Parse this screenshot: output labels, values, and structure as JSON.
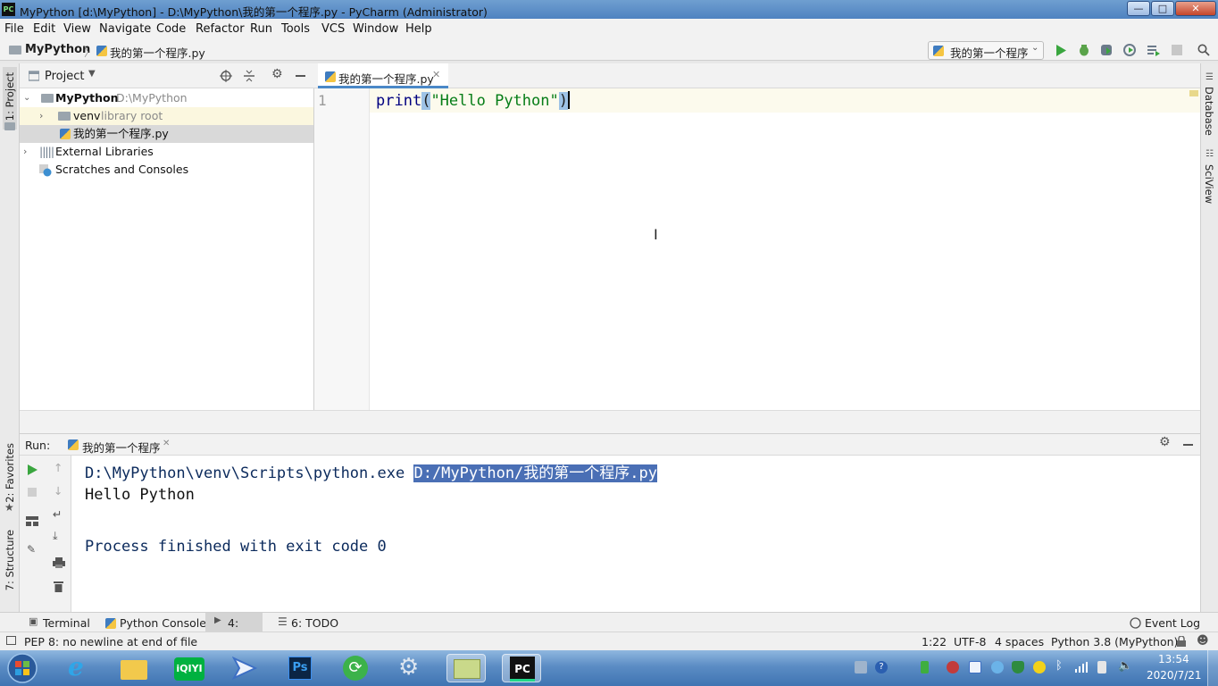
{
  "window": {
    "title": "MyPython [d:\\MyPython] - D:\\MyPython\\我的第一个程序.py - PyCharm (Administrator)",
    "app_icon_text": "PC",
    "minimize": "—",
    "maximize": "□",
    "close": "✕"
  },
  "menu": [
    "File",
    "Edit",
    "View",
    "Navigate",
    "Code",
    "Refactor",
    "Run",
    "Tools",
    "VCS",
    "Window",
    "Help"
  ],
  "breadcrumb": {
    "project": "MyPython",
    "file": "我的第一个程序.py"
  },
  "run_config": {
    "selected": "我的第一个程序"
  },
  "left_strip": {
    "project": "1: Project",
    "favorites": "2: Favorites",
    "structure": "7: Structure"
  },
  "right_strip": {
    "database": "Database",
    "sciview": "SciView"
  },
  "project_panel": {
    "title": "Project",
    "tree": {
      "root": {
        "name": "MyPython",
        "path": "D:\\MyPython"
      },
      "venv": {
        "name": "venv",
        "note": "library root"
      },
      "file": "我的第一个程序.py",
      "external": "External Libraries",
      "scratches": "Scratches and Consoles"
    }
  },
  "editor": {
    "tab": "我的第一个程序.py",
    "line_number": "1",
    "code": {
      "fn": "print",
      "open": "(",
      "str": "\"Hello Python\"",
      "close": ")"
    }
  },
  "run_panel": {
    "label": "Run:",
    "tab": "我的第一个程序",
    "output": {
      "cmd": "D:\\MyPython\\venv\\Scripts\\python.exe ",
      "script": "D:/MyPython/我的第一个程序.py",
      "hello": "Hello Python",
      "finished": "Process finished with exit code 0"
    }
  },
  "bottom_tabs": {
    "terminal": "Terminal",
    "python_console": "Python Console",
    "run": "4: Run",
    "todo": "6: TODO",
    "event_log": "Event Log"
  },
  "status": {
    "message": "PEP 8: no newline at end of file",
    "position": "1:22",
    "encoding": "UTF-8",
    "indent": "4 spaces",
    "interpreter": "Python 3.8 (MyPython)"
  },
  "taskbar": {
    "apps": [
      "windows-start",
      "internet-explorer",
      "file-explorer",
      "iqiyi",
      "feishu",
      "photoshop",
      "refresh-tool",
      "settings-tool",
      "notes",
      "pycharm"
    ],
    "ps_text": "Ps",
    "iqiyi_text": "iQIYI",
    "pc_text": "PC",
    "time": "13:54",
    "date": "2020/7/21"
  },
  "colors": {
    "keyword": "#000080",
    "string": "#067d17",
    "selection": "#4a6fb5",
    "output_text": "#0b2a5c",
    "run_green": "#3aa63f"
  }
}
